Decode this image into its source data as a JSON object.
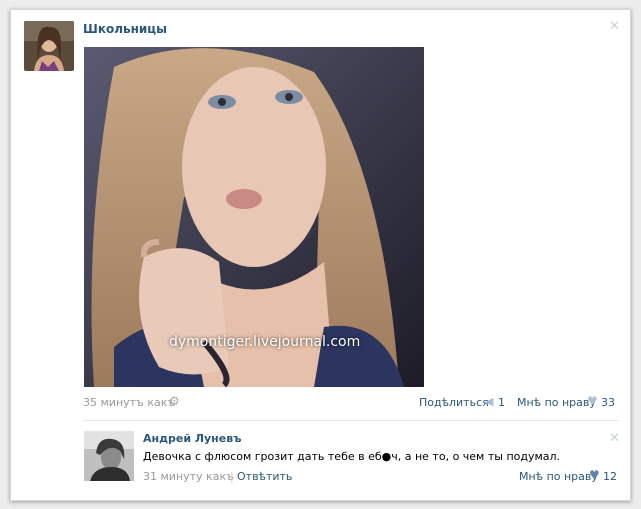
{
  "post": {
    "group_name": "Школьницы",
    "watermark": "dymontiger.livejournal.com",
    "time": "35 минутъ какъ",
    "share_label": "Подѣлиться",
    "share_count": "1",
    "like_label": "Мнѣ по нраву",
    "like_count": "33"
  },
  "comment": {
    "author": "Андрей Луневъ",
    "text": "Девочка с флюсом грозит дать тебе в еб●ч, а не то, о чем ты подумал.",
    "time": "31 минуту какъ",
    "separator": "|",
    "reply_label": "Отвѣтить",
    "like_label": "Мнѣ по нраву",
    "like_count": "12"
  },
  "icons": {
    "close": "close-icon",
    "gear": "gear-icon",
    "share": "megaphone-icon",
    "like": "heart-icon"
  },
  "colors": {
    "link": "#2b587a",
    "muted": "#999999",
    "icon_light": "#b0bfd0"
  }
}
